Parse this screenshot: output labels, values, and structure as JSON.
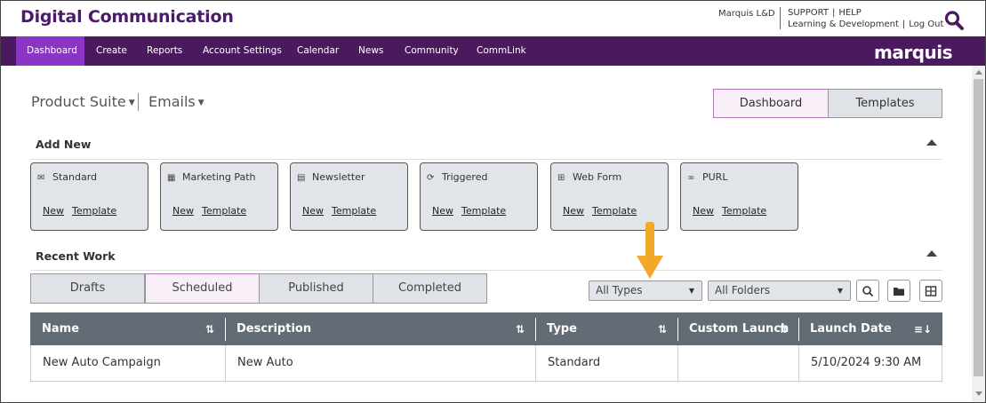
{
  "header": {
    "app_title": "Digital Communication",
    "user_name": "Marquis L&D",
    "links": {
      "support": "SUPPORT",
      "help": "HELP",
      "ld": "Learning & Development",
      "logout": "Log Out"
    }
  },
  "nav": {
    "items": [
      {
        "label": "Dashboard",
        "active": true
      },
      {
        "label": "Create"
      },
      {
        "label": "Reports"
      },
      {
        "label": "Account Settings"
      },
      {
        "label": "Calendar"
      },
      {
        "label": "News"
      },
      {
        "label": "Community"
      },
      {
        "label": "CommLink"
      }
    ],
    "logo": "marquis"
  },
  "filters": {
    "product_suite": "Product Suite",
    "emails": "Emails"
  },
  "view_toggle": {
    "dashboard": "Dashboard",
    "templates": "Templates",
    "selected": "Dashboard"
  },
  "add_new": {
    "title": "Add New",
    "cards": [
      {
        "label": "Standard",
        "icon": "envelope-icon",
        "new": "New",
        "template": "Template"
      },
      {
        "label": "Marketing Path",
        "icon": "calendar-icon",
        "new": "New",
        "template": "Template"
      },
      {
        "label": "Newsletter",
        "icon": "newspaper-icon",
        "new": "New",
        "template": "Template"
      },
      {
        "label": "Triggered",
        "icon": "refresh-icon",
        "new": "New",
        "template": "Template"
      },
      {
        "label": "Web Form",
        "icon": "table-form-icon",
        "new": "New",
        "template": "Template"
      },
      {
        "label": "PURL",
        "icon": "link-icon",
        "new": "New",
        "template": "Template"
      }
    ]
  },
  "recent_work": {
    "title": "Recent Work",
    "tabs": [
      "Drafts",
      "Scheduled",
      "Published",
      "Completed"
    ],
    "selected_tab": "Scheduled",
    "type_select": "All Types",
    "folder_select": "All Folders",
    "columns": [
      "Name",
      "Description",
      "Type",
      "Custom Launch",
      "Launch Date"
    ],
    "rows": [
      {
        "name": "New Auto Campaign",
        "description": "New Auto",
        "type": "Standard",
        "custom_launch": "",
        "launch_date": "5/10/2024 9:30 AM"
      }
    ]
  },
  "colors": {
    "nav_bg": "#4b1a5e",
    "nav_active": "#8a35c4",
    "annotation_arrow": "#f2a82a",
    "table_header": "#636b75"
  }
}
